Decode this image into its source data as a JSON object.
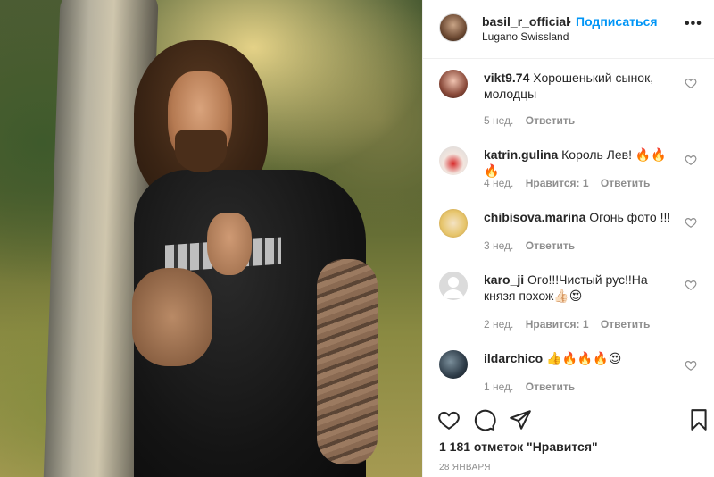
{
  "post": {
    "username": "basil_r_official",
    "separator": "•",
    "follow_label": "Подписаться",
    "location": "Lugano Swissland",
    "more_label": "•••"
  },
  "comments": [
    {
      "user": "vikt9.74",
      "text": "Хорошенький сынок, молодцы",
      "time": "5 нед.",
      "likes": "",
      "reply": "Ответить"
    },
    {
      "user": "katrin.gulina",
      "text": "Король Лев! 🔥🔥🔥",
      "time": "4 нед.",
      "likes": "Нравится: 1",
      "reply": "Ответить"
    },
    {
      "user": "chibisova.marina",
      "text": "Огонь фото !!!",
      "time": "3 нед.",
      "likes": "",
      "reply": "Ответить"
    },
    {
      "user": "karo_ji",
      "text": "Ого!!!Чистый рус!!На князя похож👍🏻😍",
      "time": "2 нед.",
      "likes": "Нравится: 1",
      "reply": "Ответить"
    },
    {
      "user": "ildarchico",
      "text": "👍🔥🔥🔥😍",
      "time": "1 нед.",
      "likes": "",
      "reply": "Ответить"
    }
  ],
  "footer": {
    "likes_text": "1 181 отметок \"Нравится\"",
    "date": "28 ЯНВАРЯ"
  },
  "icons": {
    "like": "heart-icon",
    "comment": "comment-icon",
    "share": "paper-plane-icon",
    "save": "bookmark-icon"
  }
}
